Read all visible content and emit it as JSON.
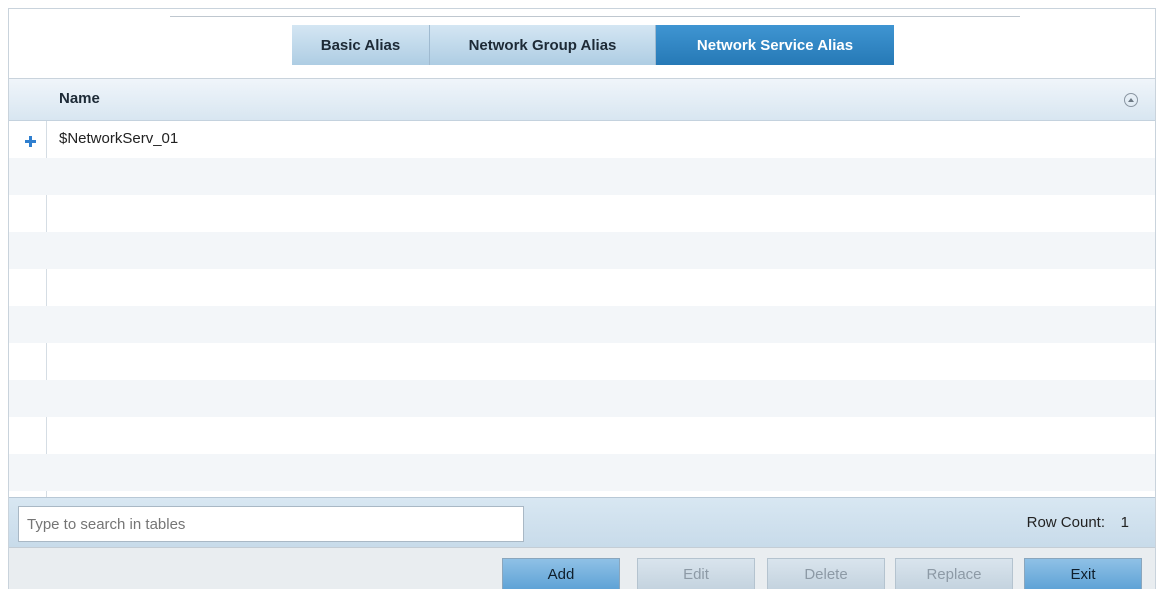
{
  "tabs": [
    {
      "label": "Basic Alias",
      "active": false
    },
    {
      "label": "Network Group Alias",
      "active": false
    },
    {
      "label": "Network Service Alias",
      "active": true
    }
  ],
  "table": {
    "columns": [
      "Name"
    ],
    "rows": [
      {
        "name": "$NetworkServ_01"
      }
    ]
  },
  "search": {
    "placeholder": "Type to search in tables",
    "value": ""
  },
  "row_count": {
    "label": "Row Count:",
    "value": "1"
  },
  "buttons": {
    "add": "Add",
    "edit": "Edit",
    "delete": "Delete",
    "replace": "Replace",
    "exit": "Exit"
  },
  "colors": {
    "active_tab": "#2f86c6",
    "inactive_tab": "#bcd7ea",
    "add_icon": "#2f7fcf",
    "button_enabled": "#72b0dd"
  },
  "icons": {
    "row_add": "plus-icon",
    "sort": "sort-ascending-icon"
  }
}
